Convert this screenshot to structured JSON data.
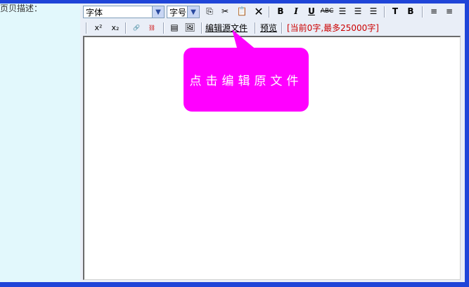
{
  "form": {
    "label": "页贝描述："
  },
  "toolbar": {
    "font_select": "字体",
    "size_select": "字号",
    "edit_source_link": "编辑源文件",
    "preview_link": "预览",
    "char_count": "[当前0字,最多25000字]",
    "bold": "B",
    "italic": "I",
    "underline": "U",
    "superscript": "x²",
    "subscript": "x₂"
  },
  "callout": {
    "text": "点击编辑原文件"
  },
  "colors": {
    "background": "#1f45d8",
    "panel": "#e2f8fc",
    "callout": "#ff00ff",
    "count_text": "#cc0000"
  }
}
